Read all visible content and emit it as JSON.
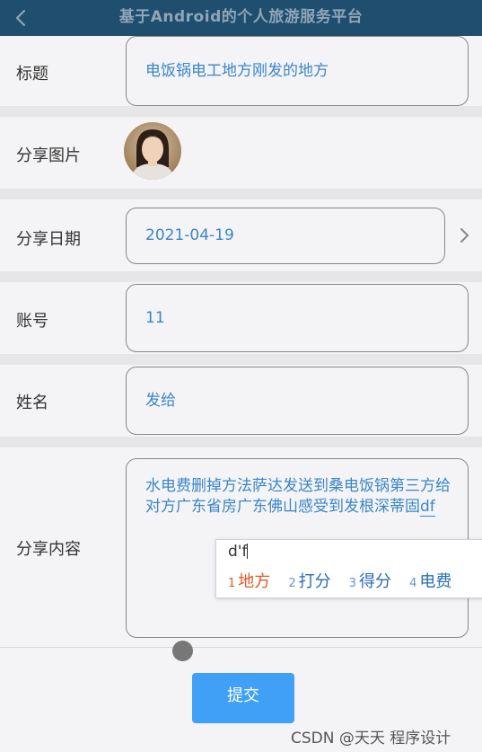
{
  "header": {
    "title": "基于Android的个人旅游服务平台",
    "back_icon": "chevron-left-icon"
  },
  "form": {
    "title": {
      "label": "标题",
      "value": "电饭锅电工地方刚发的地方"
    },
    "image": {
      "label": "分享图片",
      "alt": "avatar photo"
    },
    "date": {
      "label": "分享日期",
      "value": "2021-04-19",
      "action_icon": "chevron-right-icon"
    },
    "account": {
      "label": "账号",
      "value": "11"
    },
    "name": {
      "label": "姓名",
      "value": "发给"
    },
    "content": {
      "label": "分享内容",
      "value": "水电费删掉方法萨达发送到桑电饭锅第三方给对方广东省房广东佛山感受到发根深蒂固",
      "composing": "df"
    }
  },
  "ime": {
    "composition": "d'f",
    "candidates": [
      {
        "index": "1",
        "text": "地方"
      },
      {
        "index": "2",
        "text": "打分"
      },
      {
        "index": "3",
        "text": "得分"
      },
      {
        "index": "4",
        "text": "电费"
      }
    ]
  },
  "submit_label": "提交",
  "watermark": "CSDN @天天 程序设计",
  "colors": {
    "header_bg": "#1f4e6e",
    "field_text": "#3a86c8",
    "submit_bg": "#3fa0f5",
    "ime_highlight": "#e0582a"
  }
}
